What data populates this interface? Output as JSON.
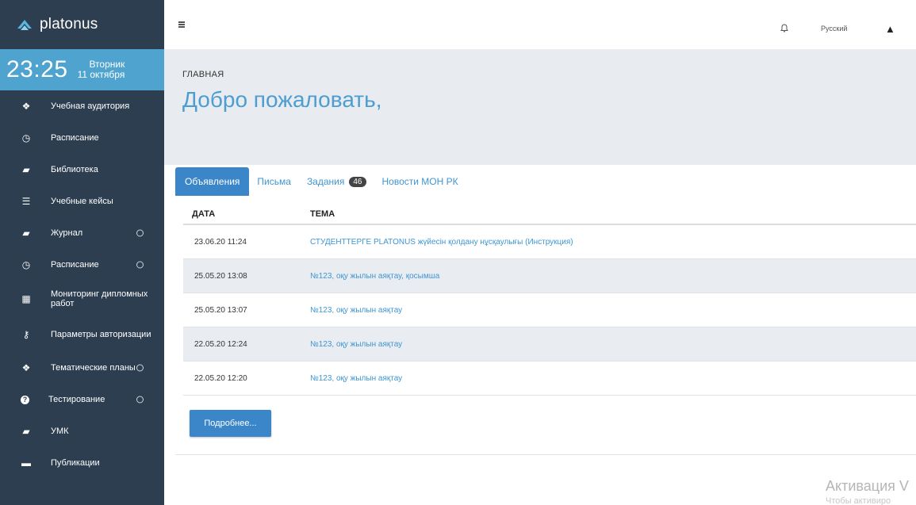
{
  "app": {
    "name": "platonus"
  },
  "clock": {
    "time": "23:25",
    "weekday": "Вторник",
    "date": "11 октября"
  },
  "sidebar": {
    "items": [
      {
        "label": "Учебная аудитория",
        "icon": "cubes-icon",
        "arrow": false
      },
      {
        "label": "Расписание",
        "icon": "clock-icon",
        "arrow": false
      },
      {
        "label": "Библиотека",
        "icon": "book-icon",
        "arrow": false
      },
      {
        "label": "Учебные кейсы",
        "icon": "list-icon",
        "arrow": false
      },
      {
        "label": "Журнал",
        "icon": "book-icon",
        "arrow": true
      },
      {
        "label": "Расписание",
        "icon": "clock-icon",
        "arrow": true
      },
      {
        "label": "Мониторинг дипломных работ",
        "icon": "calendar-icon",
        "arrow": false
      },
      {
        "label": "Параметры авторизации",
        "icon": "key-icon",
        "arrow": false
      },
      {
        "label": "Тематические планы",
        "icon": "cubes-icon",
        "arrow": true
      },
      {
        "label": "Тестирование",
        "icon": "question-icon",
        "arrow": true
      },
      {
        "label": "УМК",
        "icon": "book-icon",
        "arrow": false
      },
      {
        "label": "Публикации",
        "icon": "folder-icon",
        "arrow": false
      }
    ]
  },
  "topbar": {
    "language": "Русский"
  },
  "header": {
    "breadcrumb": "ГЛАВНАЯ",
    "title": "Добро пожаловать,"
  },
  "tabs": [
    {
      "label": "Объявления",
      "active": true
    },
    {
      "label": "Письма",
      "active": false
    },
    {
      "label": "Задания",
      "badge": "46",
      "active": false
    },
    {
      "label": "Новости МОН РК",
      "active": false
    }
  ],
  "table": {
    "headers": {
      "date": "ДАТА",
      "topic": "ТЕМА"
    },
    "rows": [
      {
        "date": "23.06.20 11:24",
        "topic": "СТУДЕНТТЕРГЕ PLATONUS жүйесін қолдану нұсқаулығы (Инструкция)"
      },
      {
        "date": "25.05.20 13:08",
        "topic": "№123, оқу жылын аяқтау, қосымша"
      },
      {
        "date": "25.05.20 13:07",
        "topic": "№123, оқу жылын аяқтау"
      },
      {
        "date": "22.05.20 12:24",
        "topic": "№123, оқу жылын аяқтау"
      },
      {
        "date": "22.05.20 12:20",
        "topic": "№123, оқу жылын аяқтау"
      }
    ]
  },
  "more_button": "Подробнее...",
  "watermark": {
    "title": "Активация V",
    "subtitle": "Чтобы активиро"
  },
  "colors": {
    "sidebar": "#2d3e50",
    "clock": "#4ea3cf",
    "accent": "#3a86c8",
    "link": "#3f95d2",
    "header_bg": "#e8ecf0"
  }
}
